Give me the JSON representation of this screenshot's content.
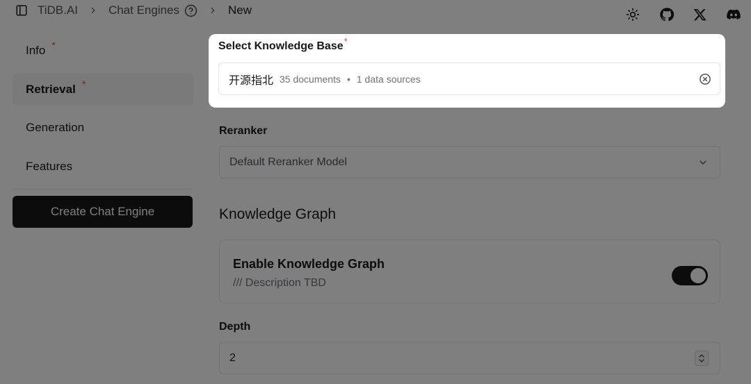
{
  "breadcrumb": {
    "items": [
      "TiDB.AI",
      "Chat Engines",
      "New"
    ]
  },
  "header_icons": [
    "theme-sun-icon",
    "github-icon",
    "x-icon",
    "discord-icon"
  ],
  "sidebar": {
    "items": [
      {
        "label": "Info",
        "required": "*"
      },
      {
        "label": "Retrieval",
        "required": "*"
      },
      {
        "label": "Generation"
      },
      {
        "label": "Features"
      }
    ],
    "create_button": "Create Chat Engine"
  },
  "knowledge_base": {
    "label": "Select Knowledge Base",
    "required": "*",
    "name": "开源指北",
    "documents": "35 documents",
    "separator": "•",
    "sources": "1 data sources"
  },
  "reranker": {
    "label": "Reranker",
    "value": "Default Reranker Model"
  },
  "knowledge_graph": {
    "section_title": "Knowledge Graph",
    "enable_title": "Enable Knowledge Graph",
    "enable_desc": "/// Description TBD",
    "enabled": true
  },
  "depth": {
    "label": "Depth",
    "value": "2"
  },
  "colors": {
    "primary": "#18181b",
    "required": "#ef4444",
    "muted": "#71717a",
    "border": "#e4e4e7"
  }
}
